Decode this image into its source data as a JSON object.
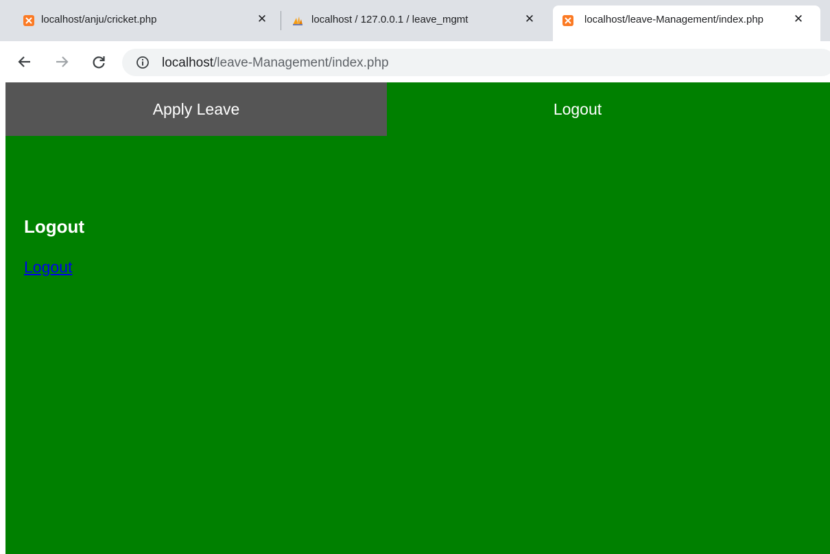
{
  "browser": {
    "tabs": [
      {
        "title": "localhost/anju/cricket.php",
        "icon": "xampp-icon",
        "active": false
      },
      {
        "title": "localhost / 127.0.0.1 / leave_mgmt",
        "icon": "phpmyadmin-icon",
        "active": false
      },
      {
        "title": "localhost/leave-Management/index.php",
        "icon": "xampp-icon",
        "active": true
      }
    ],
    "close_glyph": "✕",
    "address": {
      "host": "localhost",
      "path": "/leave-Management/index.php"
    }
  },
  "page": {
    "background": "#008000",
    "nav": {
      "items": [
        {
          "label": "Apply Leave",
          "selected": true
        },
        {
          "label": "Logout",
          "selected": false
        }
      ]
    },
    "heading": "Logout",
    "link": "Logout"
  }
}
